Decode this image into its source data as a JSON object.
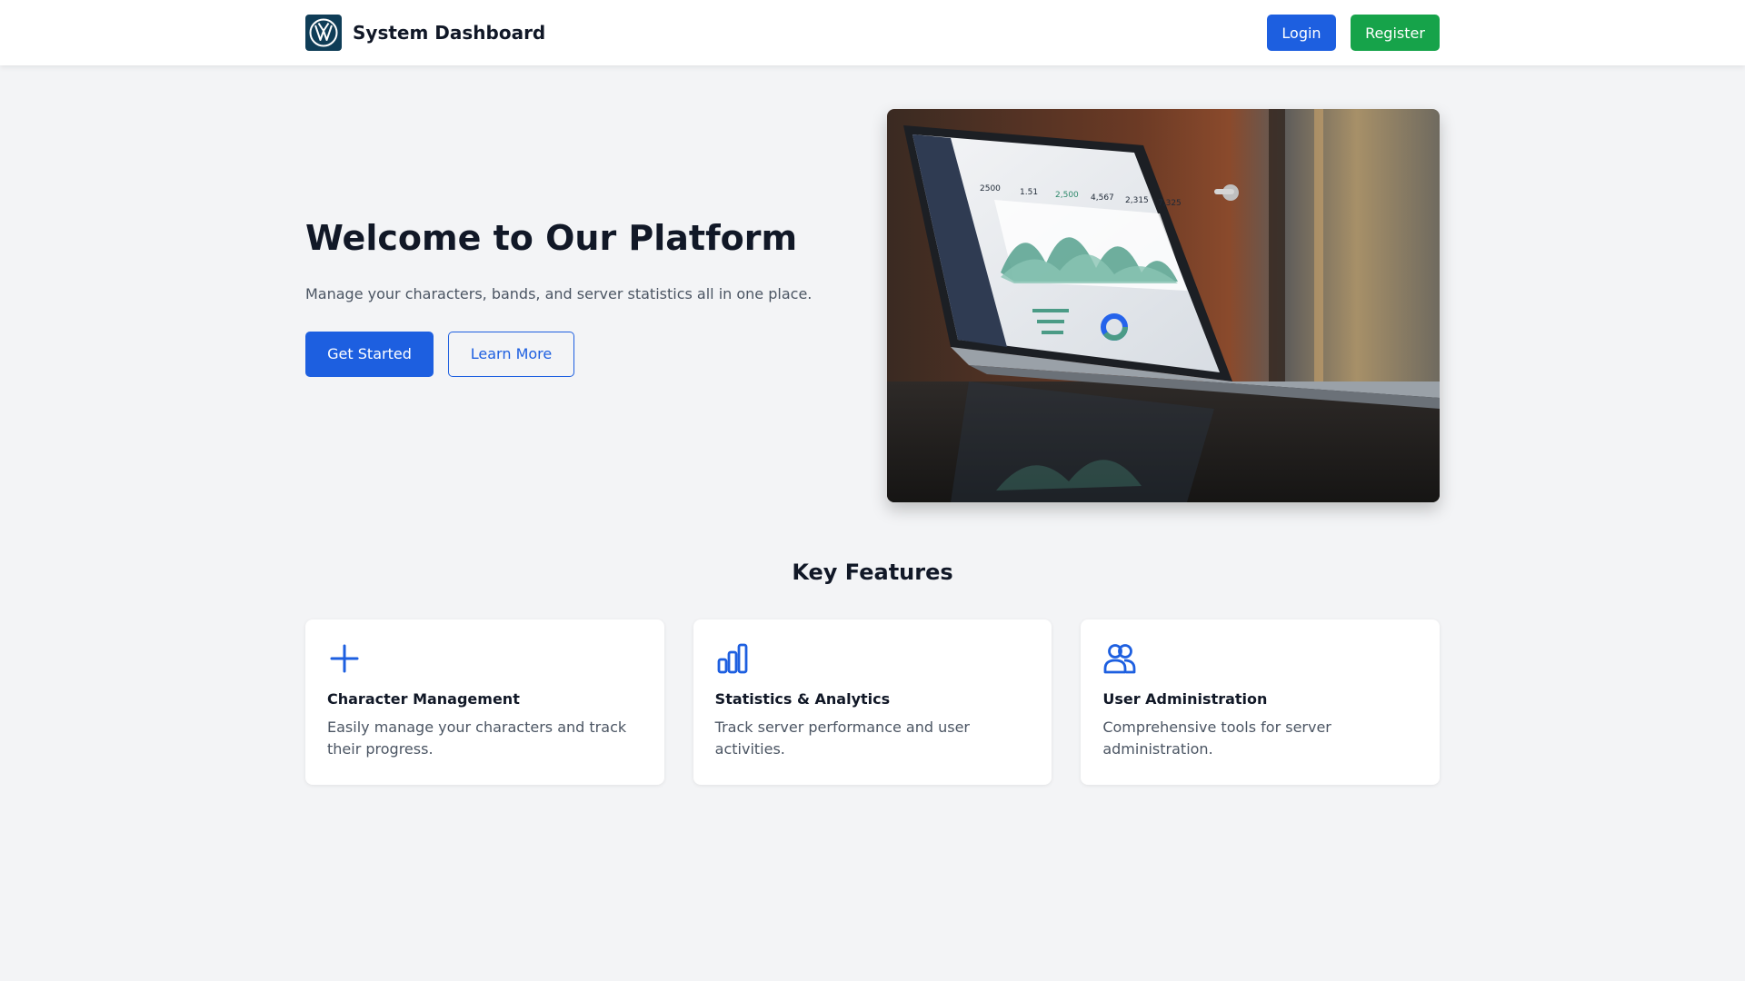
{
  "header": {
    "brand_title": "System Dashboard",
    "login_label": "Login",
    "register_label": "Register"
  },
  "hero": {
    "title": "Welcome to Our Platform",
    "subtitle": "Manage your characters, bands, and server statistics all in one place.",
    "primary_button": "Get Started",
    "secondary_button": "Learn More",
    "image": {
      "laptop_stats": [
        "2500",
        "1.51",
        "2,500",
        "4,567",
        "2,315",
        "7,325"
      ]
    }
  },
  "features": {
    "title": "Key Features",
    "items": [
      {
        "icon": "plus-icon",
        "title": "Character Management",
        "desc": "Easily manage your characters and track their progress."
      },
      {
        "icon": "bar-chart-icon",
        "title": "Statistics & Analytics",
        "desc": "Track server performance and user activities."
      },
      {
        "icon": "users-icon",
        "title": "User Administration",
        "desc": "Comprehensive tools for server administration."
      }
    ]
  },
  "colors": {
    "primary": "#1d5fe0",
    "success": "#16a34a",
    "background": "#f3f4f6",
    "logo_bg": "#0f3d57"
  }
}
